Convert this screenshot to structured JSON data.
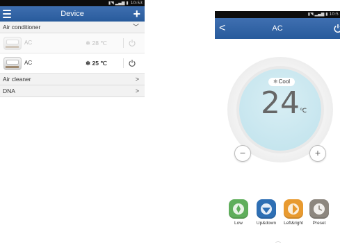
{
  "left_screen": {
    "status_time": "10:53",
    "header": {
      "title": "Device"
    },
    "sections": [
      {
        "label": "Air conditioner"
      },
      {
        "label": "Air cleaner"
      },
      {
        "label": "DNA"
      }
    ],
    "devices": [
      {
        "name": "AC",
        "temp": "28 ℃",
        "state": "disabled"
      },
      {
        "name": "AC",
        "temp": "25 ℃",
        "state": "active"
      }
    ]
  },
  "right_screen": {
    "status_time": "10:5",
    "header": {
      "title": "AC"
    },
    "mode": "Cool",
    "temperature": "24",
    "unit": "℃",
    "functions": [
      {
        "label": "Low",
        "color": "#5fae5b"
      },
      {
        "label": "Up&down",
        "color": "#2e6fb4"
      },
      {
        "label": "Left&right",
        "color": "#e89a30"
      },
      {
        "label": "Preset",
        "color": "#8d877f"
      }
    ]
  },
  "colors": {
    "header_blue": "#2f64a6",
    "dial": "#c6e6ee"
  }
}
